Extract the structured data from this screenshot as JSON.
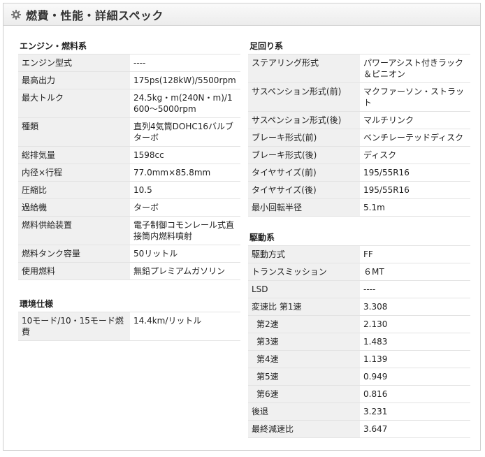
{
  "header": {
    "title": "燃費・性能・詳細スペック",
    "icon": "gear-icon"
  },
  "engine": {
    "title": "エンジン・燃料系",
    "rows": [
      [
        "エンジン型式",
        "----"
      ],
      [
        "最高出力",
        "175ps(128kW)/5500rpm"
      ],
      [
        "最大トルク",
        "24.5kg・m(240N・m)/1600～5000rpm"
      ],
      [
        "種類",
        "直列4気筒DOHC16バルブターボ"
      ],
      [
        "総排気量",
        "1598cc"
      ],
      [
        "内径×行程",
        "77.0mm×85.8mm"
      ],
      [
        "圧縮比",
        "10.5"
      ],
      [
        "過給機",
        "ターボ"
      ],
      [
        "燃料供給装置",
        "電子制御コモンレール式直接筒内燃料噴射"
      ],
      [
        "燃料タンク容量",
        "50リットル"
      ],
      [
        "使用燃料",
        "無鉛プレミアムガソリン"
      ]
    ]
  },
  "environment": {
    "title": "環境仕様",
    "rows": [
      [
        "10モード/10・15モード燃費",
        "14.4km/リットル"
      ]
    ]
  },
  "suspension": {
    "title": "足回り系",
    "rows": [
      [
        "ステアリング形式",
        "パワーアシスト付きラック＆ピニオン"
      ],
      [
        "サスペンション形式(前)",
        "マクファーソン・ストラット"
      ],
      [
        "サスペンション形式(後)",
        "マルチリンク"
      ],
      [
        "ブレーキ形式(前)",
        "ベンチレーテッドディスク"
      ],
      [
        "ブレーキ形式(後)",
        "ディスク"
      ],
      [
        "タイヤサイズ(前)",
        "195/55R16"
      ],
      [
        "タイヤサイズ(後)",
        "195/55R16"
      ],
      [
        "最小回転半径",
        "5.1m"
      ]
    ]
  },
  "drive": {
    "title": "駆動系",
    "rows": [
      [
        "駆動方式",
        "FF"
      ],
      [
        "トランスミッション",
        "６MT"
      ],
      [
        "LSD",
        "----"
      ],
      [
        "変速比 第1速",
        "3.308"
      ],
      [
        "第2速",
        "2.130"
      ],
      [
        "第3速",
        "1.483"
      ],
      [
        "第4速",
        "1.139"
      ],
      [
        "第5速",
        "0.949"
      ],
      [
        "第6速",
        "0.816"
      ],
      [
        "後退",
        "3.231"
      ],
      [
        "最終減速比",
        "3.647"
      ]
    ]
  }
}
